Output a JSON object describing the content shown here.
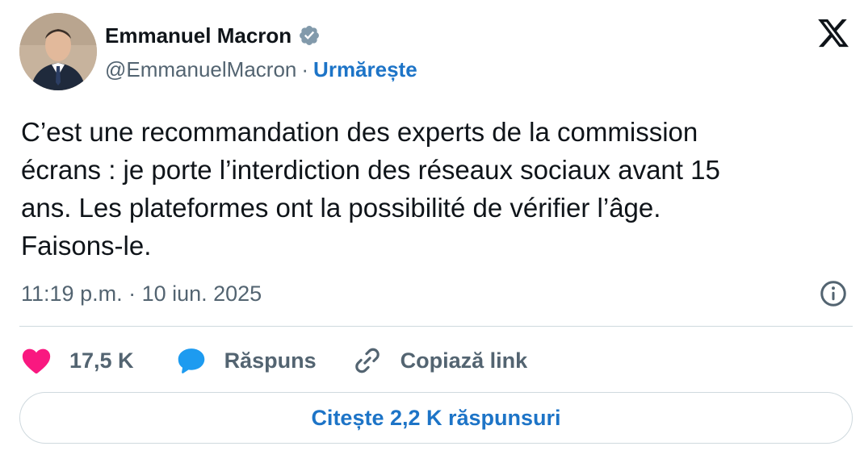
{
  "author": {
    "name": "Emmanuel Macron",
    "handle": "@EmmanuelMacron",
    "separator": "·",
    "follow_label": "Urmărește",
    "verified_icon": "verified-badge-icon",
    "avatar_icon": "profile-photo"
  },
  "tweet": {
    "text": "C’est une recommandation des experts de la commission\nécrans : je porte l’interdiction des réseaux sociaux avant 15\nans. Les plateformes ont la possibilité de vérifier l’âge.\nFaisons-le.",
    "timestamp": "11:19 p.m. · 10 iun. 2025"
  },
  "actions": {
    "likes_count": "17,5 K",
    "reply_label": "Răspuns",
    "copy_link_label": "Copiază link"
  },
  "read_replies_label": "Citește 2,2 K răspunsuri",
  "colors": {
    "accent": "#1d74c7",
    "heart": "#f91880",
    "reply_bubble": "#1d9bf0",
    "muted": "#536471",
    "text": "#0f1419",
    "border": "#cfd9de"
  }
}
